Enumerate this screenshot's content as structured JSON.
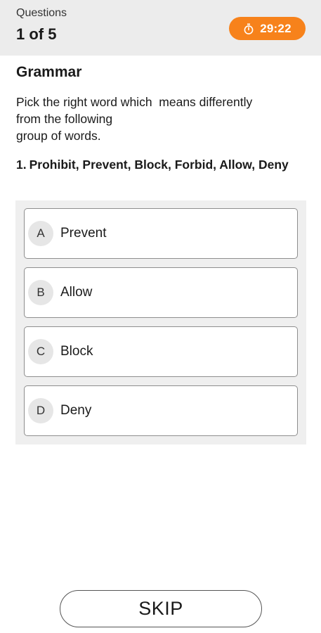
{
  "header": {
    "caption": "Questions",
    "progress": "1 of 5",
    "timer": {
      "icon": "stopwatch-icon",
      "value": "29:22",
      "color": "#f7821b"
    }
  },
  "subject": "Grammar",
  "instruction": "Pick the right word which  means differently\nfrom the following\ngroup of words.",
  "question": {
    "number": "1.",
    "text": "Prohibit, Prevent, Block, Forbid, Allow, Deny"
  },
  "options": [
    {
      "letter": "A",
      "text": "Prevent"
    },
    {
      "letter": "B",
      "text": "Allow"
    },
    {
      "letter": "C",
      "text": "Block"
    },
    {
      "letter": "D",
      "text": "Deny"
    }
  ],
  "skip_label": "SKIP"
}
